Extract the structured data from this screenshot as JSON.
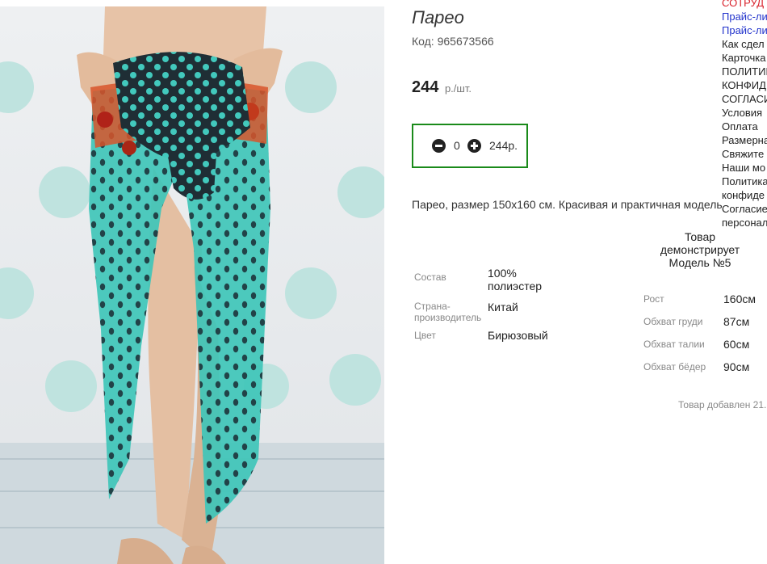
{
  "product": {
    "title": "Парео",
    "code": "Код: 965673566",
    "price": "244",
    "price_unit": "р./шт.",
    "quantity": "0",
    "sum": "244р.",
    "description": "Парео, размер 150х160 см. Красивая и практичная модель"
  },
  "props": [
    {
      "key": "Состав",
      "value": "100% полиэстер"
    },
    {
      "key": "Страна-производитель",
      "value": "Китай"
    },
    {
      "key": "Цвет",
      "value": "Бирюзовый"
    }
  ],
  "model": {
    "heading": "Товар демонстрирует Модель №5",
    "params": [
      {
        "key": "Рост",
        "value": "160см"
      },
      {
        "key": "Обхват груди",
        "value": "87см"
      },
      {
        "key": "Обхват талии",
        "value": "60см"
      },
      {
        "key": "Обхват бёдер",
        "value": "90см"
      }
    ]
  },
  "added": "Товар добавлен 21.",
  "side_menu": [
    "СОТРУД",
    "Прайс-ли",
    "Прайс-ли",
    "Как сдел",
    "Карточка",
    "ПОЛИТИК",
    "КОНФИД",
    "СОГЛАСИ",
    "Условия",
    "Оплата",
    "Размерна",
    "Свяжите",
    "Наши мо",
    "Политика",
    "конфиде",
    "Согласие",
    "персонал"
  ],
  "colors": {
    "qty_border": "#1a8a1a",
    "menu_red": "#d8202a",
    "menu_blue": "#2233cc",
    "pareo": "#3fc6b9"
  }
}
